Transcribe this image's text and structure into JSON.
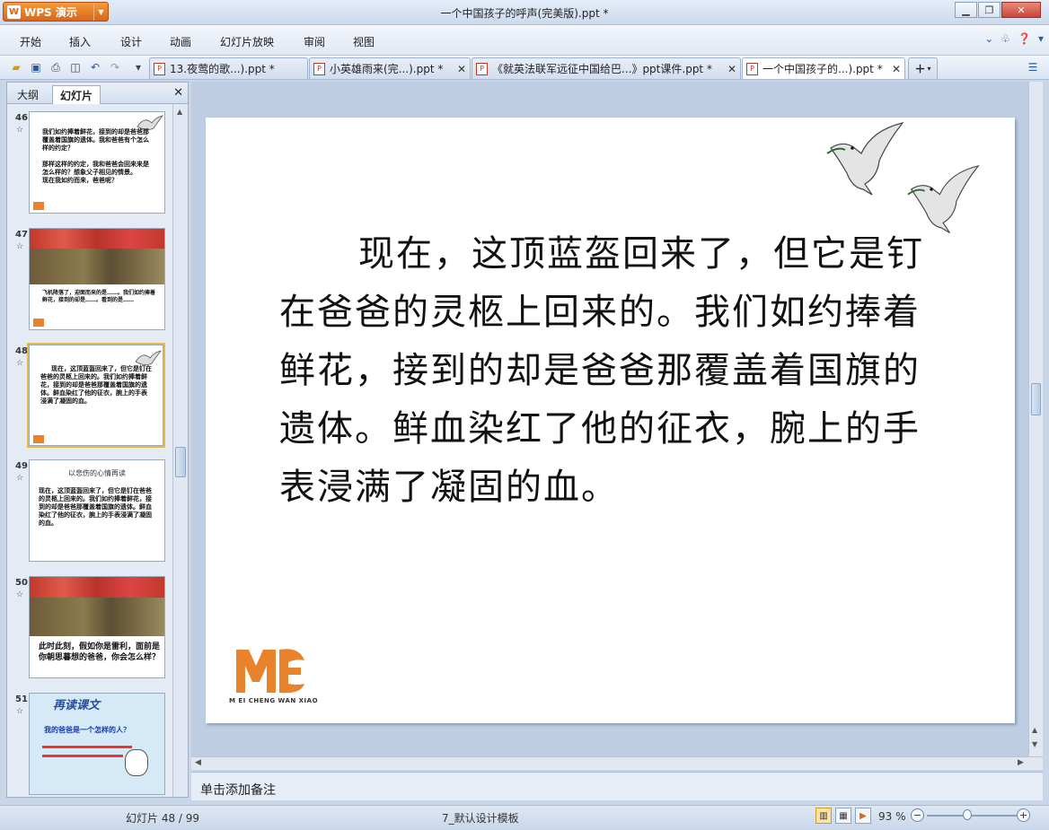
{
  "app": {
    "name": "WPS 演示",
    "logo": "W",
    "window_title": "一个中国孩子的呼声(完美版).ppt *"
  },
  "menu": [
    "开始",
    "插入",
    "设计",
    "动画",
    "幻灯片放映",
    "审阅",
    "视图"
  ],
  "tabs": [
    {
      "label": "13.夜莺的歌...).ppt *"
    },
    {
      "label": "小英雄雨来(完...).ppt *"
    },
    {
      "label": "《就英法联军远征中国给巴...》ppt课件.ppt *"
    },
    {
      "label": "一个中国孩子的...).ppt *",
      "active": true
    }
  ],
  "panel": {
    "tab_outline": "大纲",
    "tab_slides": "幻灯片"
  },
  "thumbnails": [
    {
      "num": "46",
      "text": "我们如约捧着鲜花，接到的却是爸爸那覆盖着国旗的遗体。我和爸爸有个怎么样的约定？\n\n那样这样的约定，我和爸爸会回来来是怎么样的？想象父子相见的情景。\n现在我如约而来，爸爸呢？"
    },
    {
      "num": "47",
      "text": "飞机降落了，迎面而来的是……。我们如约捧着鲜花，接到的却是……。看到的是……"
    },
    {
      "num": "48",
      "text": "现在，这顶蓝盔回来了，但它是钉在爸爸的灵柩上回来的。我们如约捧着鲜花，接到的却是爸爸那覆盖着国旗的遗体。鲜血染红了他的征衣，腕上的手表浸满了凝固的血。"
    },
    {
      "num": "49",
      "title": "以悲伤的心情再读",
      "text": "现在，这顶蓝盔回来了，但它是钉在爸爸的灵柩上回来的。我们如约捧着鲜花，接到的却是爸爸那覆盖着国旗的遗体。鲜血染红了他的征衣，腕上的手表浸满了凝固的血。"
    },
    {
      "num": "50",
      "text": "此时此刻，假如你是雷利，面前是你朝思暮想的爸爸，你会怎么样？"
    },
    {
      "num": "51",
      "title": "再读课文",
      "text": "我的爸爸是一个怎样的人？"
    }
  ],
  "slide": {
    "body": "现在，这顶蓝盔回来了，但它是钉在爸爸的灵柩上回来的。我们如约捧着鲜花，接到的却是爸爸那覆盖着国旗的遗体。鲜血染红了他的征衣，腕上的手表浸满了凝固的血。",
    "logo_text": "M EI CHENG WAN XIAO"
  },
  "notes_placeholder": "单击添加备注",
  "status": {
    "slide_pos": "幻灯片 48 / 99",
    "template": "7_默认设计模板",
    "zoom": "93 %"
  },
  "colors": {
    "accent": "#e8832b",
    "selected": "#e9b948"
  }
}
